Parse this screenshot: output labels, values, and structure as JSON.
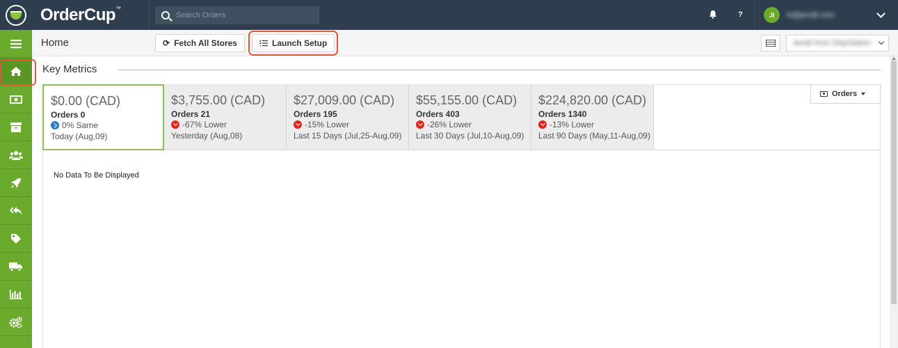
{
  "app": {
    "brand": "OrderCup",
    "brand_tm": "™"
  },
  "search": {
    "placeholder": "Search Orders"
  },
  "topbar": {
    "help": "?",
    "user_initials": "JI",
    "user_name": "hi@jendii.com"
  },
  "sidebar": {
    "items": [
      {
        "name": "menu",
        "icon": "hamburger-icon",
        "active": false
      },
      {
        "name": "home",
        "icon": "home-icon",
        "active": true
      },
      {
        "name": "money",
        "icon": "money-icon",
        "active": false
      },
      {
        "name": "archive",
        "icon": "archive-icon",
        "active": false
      },
      {
        "name": "users",
        "icon": "users-icon",
        "active": false
      },
      {
        "name": "launch",
        "icon": "rocket-icon",
        "active": false
      },
      {
        "name": "returns",
        "icon": "reply-all-icon",
        "active": false
      },
      {
        "name": "tags",
        "icon": "tag-icon",
        "active": false
      },
      {
        "name": "shipping",
        "icon": "truck-icon",
        "active": false
      },
      {
        "name": "reports",
        "icon": "bar-chart-icon",
        "active": false
      },
      {
        "name": "settings",
        "icon": "gears-icon",
        "active": false
      }
    ]
  },
  "subheader": {
    "title": "Home",
    "fetch_label": "Fetch All Stores",
    "launch_label": "Launch Setup",
    "store_value": "Jendii from ShipStation"
  },
  "key_metrics": {
    "title": "Key Metrics",
    "orders_dropdown": "Orders",
    "metrics": [
      {
        "amount": "$0.00 (CAD)",
        "orders": "Orders 0",
        "change": "0% Same",
        "direction": "same",
        "period": "Today (Aug,09)"
      },
      {
        "amount": "$3,755.00 (CAD)",
        "orders": "Orders 21",
        "change": "-67% Lower",
        "direction": "down",
        "period": "Yesterday (Aug,08)"
      },
      {
        "amount": "$27,009.00 (CAD)",
        "orders": "Orders 195",
        "change": "-15% Lower",
        "direction": "down",
        "period": "Last 15 Days (Jul,25-Aug,09)"
      },
      {
        "amount": "$55,155.00 (CAD)",
        "orders": "Orders 403",
        "change": "-26% Lower",
        "direction": "down",
        "period": "Last 30 Days (Jul,10-Aug,09)"
      },
      {
        "amount": "$224,820.00 (CAD)",
        "orders": "Orders 1340",
        "change": "-13% Lower",
        "direction": "down",
        "period": "Last 90 Days (May,11-Aug,09)"
      }
    ],
    "empty_message": "No Data To Be Displayed"
  },
  "colors": {
    "topbar": "#2e3e4e",
    "sidebar": "#6aaa2d",
    "highlight": "#e0583c",
    "down": "#e0251b",
    "same": "#2a7fc1"
  }
}
